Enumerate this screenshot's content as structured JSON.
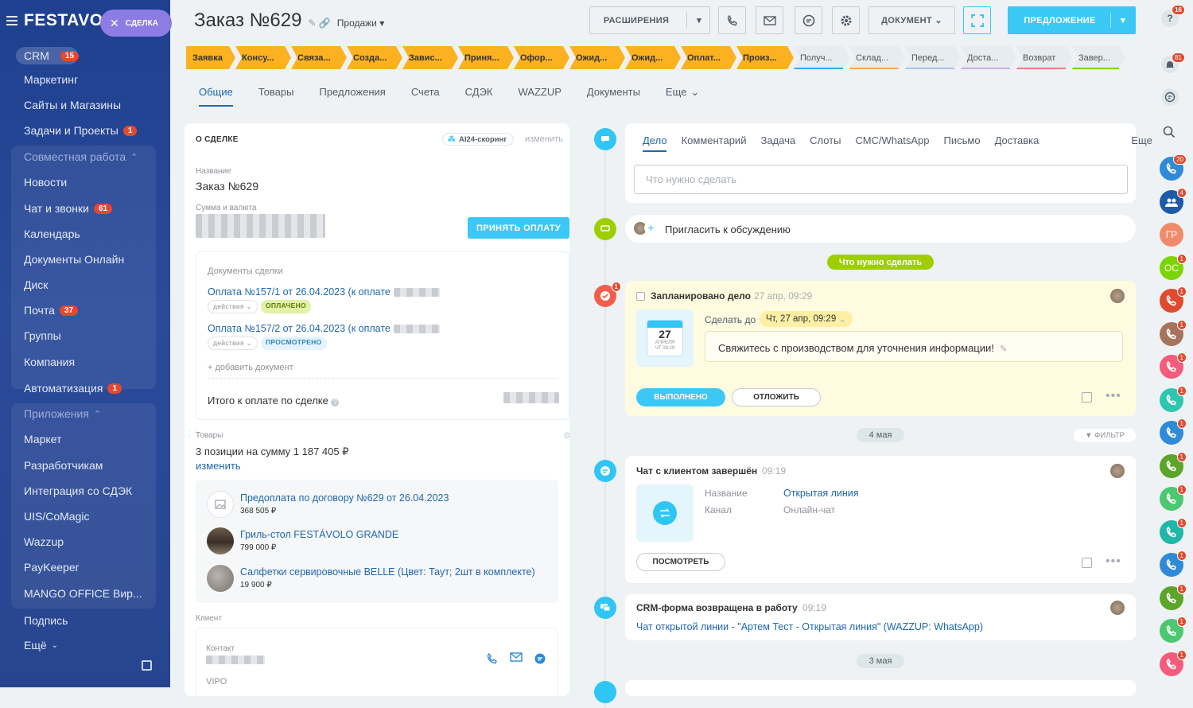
{
  "sidebar": {
    "logo": "FESTAVOL",
    "deal_chip": "СДЕЛКА",
    "crm": {
      "label": "CRM",
      "count": "15"
    },
    "items": [
      {
        "label": "Маркетинг"
      },
      {
        "label": "Сайты и Магазины"
      },
      {
        "label": "Задачи и Проекты",
        "count": "1"
      },
      {
        "label": "Совместная работа"
      },
      {
        "label": "Новости"
      },
      {
        "label": "Чат и звонки",
        "count": "61"
      },
      {
        "label": "Календарь"
      },
      {
        "label": "Документы Онлайн"
      },
      {
        "label": "Диск"
      },
      {
        "label": "Почта",
        "count": "37"
      },
      {
        "label": "Группы"
      },
      {
        "label": "Компания"
      },
      {
        "label": "Автоматизация",
        "count": "1"
      },
      {
        "label": "Приложения"
      },
      {
        "label": "Маркет"
      },
      {
        "label": "Разработчикам"
      },
      {
        "label": "Интеграция со СДЭК"
      },
      {
        "label": "UIS/CoMagic"
      },
      {
        "label": "Wazzup"
      },
      {
        "label": "PayKeeper"
      },
      {
        "label": "MANGO OFFICE Вир..."
      },
      {
        "label": "Подпись"
      },
      {
        "label": "Ещё"
      }
    ]
  },
  "header": {
    "title": "Заказ №629",
    "category": "Продажи",
    "extensions_label": "РАСШИРЕНИЯ",
    "document_label": "ДОКУМЕНТ",
    "proposal_label": "ПРЕДЛОЖЕНИЕ"
  },
  "stages": [
    {
      "label": "Заявка",
      "state": "active",
      "color": "#fbb120"
    },
    {
      "label": "Консу...",
      "state": "active",
      "color": "#fbb120"
    },
    {
      "label": "Связа...",
      "state": "active",
      "color": "#fbb120"
    },
    {
      "label": "Созда...",
      "state": "active",
      "color": "#fbb120"
    },
    {
      "label": "Завис...",
      "state": "active",
      "color": "#fbb120"
    },
    {
      "label": "Приня...",
      "state": "active",
      "color": "#fbb120"
    },
    {
      "label": "Офор...",
      "state": "active",
      "color": "#fbb120"
    },
    {
      "label": "Ожид...",
      "state": "active",
      "color": "#fbb120"
    },
    {
      "label": "Ожид...",
      "state": "active",
      "color": "#fbb120"
    },
    {
      "label": "Оплат...",
      "state": "active",
      "color": "#fbb120"
    },
    {
      "label": "Произ...",
      "state": "active",
      "color": "#fbb120"
    },
    {
      "label": "Получ...",
      "state": "inactive",
      "color": "#39a8ef"
    },
    {
      "label": "Склад...",
      "state": "inactive",
      "color": "#f5a766"
    },
    {
      "label": "Перед...",
      "state": "inactive",
      "color": "#a9c1e8"
    },
    {
      "label": "Доста...",
      "state": "inactive",
      "color": "#c7b0e3"
    },
    {
      "label": "Возврат",
      "state": "inactive",
      "color": "#f07d7d"
    },
    {
      "label": "Завер...",
      "state": "inactive",
      "color": "#7bd500"
    }
  ],
  "tabs": [
    "Общие",
    "Товары",
    "Предложения",
    "Счета",
    "СДЭК",
    "WAZZUP",
    "Документы",
    "Еще"
  ],
  "about": {
    "heading": "О СДЕЛКЕ",
    "scoring": "AI24-скоринг",
    "change": "изменить",
    "name_label": "Название",
    "name_value": "Заказ №629",
    "sum_label": "Сумма и валюта",
    "accept_payment": "ПРИНЯТЬ ОПЛАТУ",
    "docs_label": "Документы сделки",
    "docs": [
      {
        "title": "Оплата №157/1 от 26.04.2023 (к оплате",
        "actions": "действия",
        "status": "ОПЛАЧЕНО"
      },
      {
        "title": "Оплата №157/2 от 26.04.2023 (к оплате",
        "actions": "действия",
        "status": "ПРОСМОТРЕНО"
      }
    ],
    "add_doc": "+ добавить документ",
    "total_label": "Итого к оплате по сделке"
  },
  "products": {
    "label": "Товары",
    "summary": "3 позиции на сумму 1 187 405 ₽",
    "change": "изменить",
    "items": [
      {
        "name": "Предоплата по договору №629 от 26.04.2023",
        "price": "368 505 ₽"
      },
      {
        "name": "Гриль-стол FESTÁVOLO GRANDE",
        "price": "799 000 ₽"
      },
      {
        "name": "Салфетки сервировочные BELLE (Цвет: Таут; 2шт в комплекте)",
        "price": "19 900 ₽"
      }
    ]
  },
  "client": {
    "label": "Клиент",
    "contact_label": "Контакт",
    "company_short": "VIPO"
  },
  "activity": {
    "tabs": [
      "Дело",
      "Комментарий",
      "Задача",
      "Слоты",
      "СМС/WhatsApp",
      "Письмо",
      "Доставка",
      "Еще"
    ],
    "placeholder": "Что нужно сделать",
    "invite": "Пригласить к обсуждению",
    "todo_pill": "Что нужно сделать"
  },
  "task": {
    "title": "Запланировано дело",
    "time": "27 апр, 09:29",
    "deadline_label": "Сделать до",
    "deadline": "Чт, 27 апр, 09:29",
    "cal_day": "27",
    "cal_month": "АПРЕЛЯ",
    "cal_time": "ЧТ 09:29",
    "text": "Свяжитесь с производством для уточнения информации!",
    "done": "ВЫПОЛНЕНО",
    "postpone": "ОТЛОЖИТЬ",
    "badge": "1"
  },
  "date_may4": "4 мая",
  "filter": "ФИЛЬТР",
  "chat": {
    "title": "Чат с клиентом завершён",
    "time": "09:19",
    "name_label": "Название",
    "name_value": "Открытая линия",
    "channel_label": "Канал",
    "channel_value": "Онлайн-чат",
    "view": "ПОСМОТРЕТЬ"
  },
  "form": {
    "title": "CRM-форма возвращена в работу",
    "time": "09:19",
    "link": "Чат открытой линии - \"Артем Тест - Открытая линия\" (WAZZUP: WhatsApp)"
  },
  "date_may3": "3 мая",
  "rbar": {
    "help_badge": "16",
    "bell_badge": "81",
    "avatars": [
      {
        "type": "phone",
        "color": "#2f8ad8",
        "badge": "20"
      },
      {
        "type": "group",
        "color": "#1d5aa8",
        "badge": "4"
      },
      {
        "type": "text",
        "label": "ГР",
        "color": "#f08a6a"
      },
      {
        "type": "text",
        "label": "ОС",
        "color": "#7bd500",
        "badge": "1"
      },
      {
        "type": "phone",
        "color": "#e04a2f",
        "badge": "1"
      },
      {
        "type": "phone",
        "color": "#a5745a",
        "badge": "1"
      },
      {
        "type": "phone",
        "color": "#f55b7a",
        "badge": "1"
      },
      {
        "type": "phone",
        "color": "#2fc6b0",
        "badge": "1"
      },
      {
        "type": "phone",
        "color": "#2f8ad8",
        "badge": "1"
      },
      {
        "type": "phone",
        "color": "#5aa52a",
        "badge": "1"
      },
      {
        "type": "phone",
        "color": "#4cc870",
        "badge": "1"
      },
      {
        "type": "phone",
        "color": "#1fb7a8",
        "badge": "1"
      },
      {
        "type": "phone",
        "color": "#2f8ad8",
        "badge": "1"
      },
      {
        "type": "phone",
        "color": "#5aa52a",
        "badge": "1"
      },
      {
        "type": "phone",
        "color": "#4cc870",
        "badge": "1"
      },
      {
        "type": "phone",
        "color": "#f55b7a",
        "badge": "1"
      }
    ]
  }
}
